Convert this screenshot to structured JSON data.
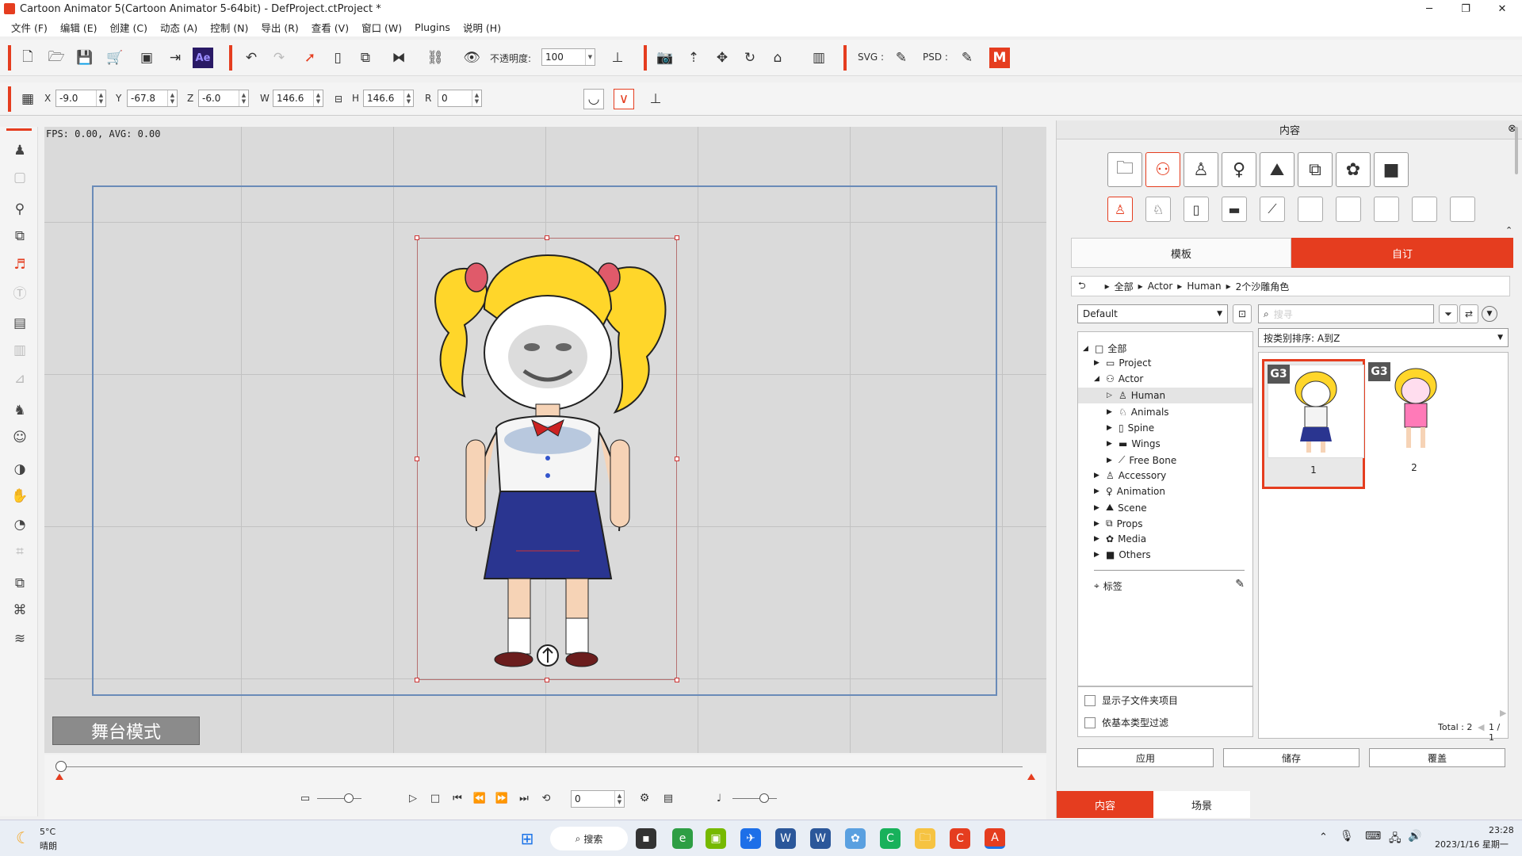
{
  "window": {
    "title": "Cartoon Animator 5(Cartoon Animator 5-64bit) - DefProject.ctProject *"
  },
  "menu": [
    "文件 (F)",
    "编辑 (E)",
    "创建 (C)",
    "动态 (A)",
    "控制 (N)",
    "导出 (R)",
    "查看 (V)",
    "窗口 (W)",
    "Plugins",
    "说明 (H)"
  ],
  "toolbar": {
    "opacity_label": "不透明度:",
    "opacity_value": "100",
    "svg_label": "SVG :",
    "psd_label": "PSD :",
    "ae_label": "Ae"
  },
  "transform": {
    "x_label": "X",
    "x": "-9.0",
    "y_label": "Y",
    "y": "-67.8",
    "z_label": "Z",
    "z": "-6.0",
    "w_label": "W",
    "w": "146.6",
    "h_label": "H",
    "h": "146.6",
    "r_label": "R",
    "r": "0"
  },
  "stage": {
    "fps_text": "FPS: 0.00, AVG: 0.00",
    "mode_label": "舞台模式"
  },
  "timeline": {
    "frame": "0"
  },
  "panel": {
    "title": "内容",
    "tabs": {
      "template": "模板",
      "custom": "自订"
    },
    "breadcrumb": [
      "全部",
      "Actor",
      "Human",
      "2个沙雕角色"
    ],
    "preset": "Default",
    "search_placeholder": "搜寻",
    "sort": "按类别排序: A到Z",
    "tree": [
      {
        "label": "全部",
        "level": 0
      },
      {
        "label": "Project",
        "level": 1
      },
      {
        "label": "Actor",
        "level": 1
      },
      {
        "label": "Human",
        "level": 2
      },
      {
        "label": "Animals",
        "level": 2
      },
      {
        "label": "Spine",
        "level": 2
      },
      {
        "label": "Wings",
        "level": 2
      },
      {
        "label": "Free Bone",
        "level": 2
      },
      {
        "label": "Accessory",
        "level": 1
      },
      {
        "label": "Animation",
        "level": 1
      },
      {
        "label": "Scene",
        "level": 1
      },
      {
        "label": "Props",
        "level": 1
      },
      {
        "label": "Media",
        "level": 1
      },
      {
        "label": "Others",
        "level": 1
      }
    ],
    "tags_label": "标签",
    "items": [
      {
        "badge": "G3",
        "label": "1"
      },
      {
        "badge": "G3",
        "label": "2"
      }
    ],
    "show_subfolder": "显示子文件夹项目",
    "filter_basic": "依基本类型过滤",
    "total": "Total : 2",
    "page": "1 / 1",
    "buttons": {
      "apply": "应用",
      "save": "储存",
      "overwrite": "覆盖"
    },
    "bottom_tabs": {
      "content": "内容",
      "scene": "场景"
    }
  },
  "taskbar": {
    "temp": "5°C",
    "weather": "晴朗",
    "search": "搜索",
    "time": "23:28",
    "date": "2023/1/16 星期一"
  },
  "colors": {
    "accent": "#e53d1f",
    "stage_bg": "#dadada",
    "camera_border": "#6a8bb8"
  }
}
